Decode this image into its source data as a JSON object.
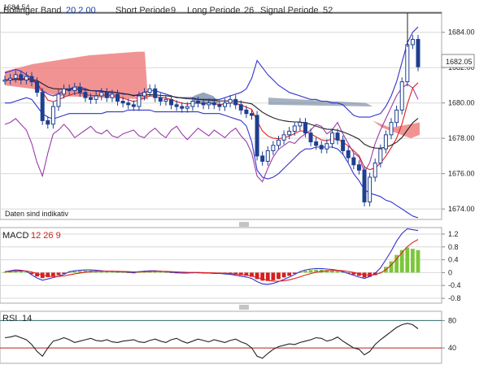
{
  "colors": {
    "background": "#ffffff",
    "frame": "#aaaaaa",
    "grid": "#d8d8d8",
    "candle": "#1f3f8f",
    "bollinger": "#3333cc",
    "cloud_red": "#f08080",
    "cloud_dark": "#6a7f9a",
    "line_red": "#e02020",
    "line_purple": "#9a3aa8",
    "line_black": "#222222",
    "macd_pos": "#7cc63a",
    "macd_neg": "#d42020",
    "rsi_line": "#4a7a7a"
  },
  "header": {
    "price_tag": "1684.54",
    "legend": [
      {
        "name": "Bollinger Band",
        "params": "20  2.00"
      },
      {
        "name": "Short Periode",
        "params": "9"
      },
      {
        "name": "Long Periode",
        "params": "26"
      },
      {
        "name": "Signal Periode",
        "params": "52"
      }
    ]
  },
  "notice": "Daten sind indikativ",
  "current_price_label": "1682.05",
  "macd": {
    "label": "MACD",
    "params": "12  26  9"
  },
  "rsi": {
    "label": "RSI",
    "params": "14"
  },
  "chart_data": [
    {
      "type": "candlestick",
      "ylim": [
        1673.5,
        1685.0
      ],
      "yticks": [
        "1674.00",
        "1676.00",
        "1678.00",
        "1680.00",
        "1682.00",
        "1684.00"
      ],
      "current_price": 1682.05,
      "close": [
        1681.3,
        1681.4,
        1681.6,
        1681.3,
        1681.5,
        1681.2,
        1680.6,
        1679.0,
        1678.8,
        1679.8,
        1680.5,
        1680.8,
        1680.7,
        1680.9,
        1680.6,
        1680.3,
        1680.2,
        1680.4,
        1680.6,
        1680.3,
        1680.5,
        1680.1,
        1680.0,
        1679.9,
        1679.8,
        1680.4,
        1680.6,
        1680.8,
        1680.3,
        1680.1,
        1680.2,
        1679.9,
        1679.8,
        1679.7,
        1679.8,
        1680.1,
        1680.0,
        1679.9,
        1680.0,
        1679.9,
        1679.8,
        1680.0,
        1680.2,
        1679.9,
        1679.6,
        1679.4,
        1679.3,
        1677.0,
        1676.7,
        1677.3,
        1677.6,
        1677.9,
        1678.2,
        1678.4,
        1678.7,
        1678.9,
        1678.3,
        1677.8,
        1677.6,
        1677.4,
        1677.7,
        1678.3,
        1677.9,
        1677.3,
        1676.9,
        1676.5,
        1676.2,
        1674.4,
        1675.8,
        1676.6,
        1677.4,
        1678.2,
        1678.9,
        1679.6,
        1681.2,
        1683.3,
        1683.6,
        1682.05
      ],
      "upper_band": [
        1681.7,
        1681.8,
        1681.9,
        1681.8,
        1681.6,
        1681.4,
        1681.0,
        1680.7,
        1680.5,
        1680.4,
        1680.5,
        1680.7,
        1680.8,
        1680.9,
        1680.9,
        1680.8,
        1680.7,
        1680.7,
        1680.7,
        1680.6,
        1680.6,
        1680.6,
        1680.5,
        1680.5,
        1680.4,
        1680.5,
        1680.6,
        1680.7,
        1680.7,
        1680.6,
        1680.5,
        1680.4,
        1680.3,
        1680.3,
        1680.3,
        1680.3,
        1680.2,
        1680.2,
        1680.2,
        1680.2,
        1680.2,
        1680.3,
        1680.4,
        1680.5,
        1680.6,
        1680.8,
        1681.4,
        1682.4,
        1682.0,
        1681.6,
        1681.3,
        1681.0,
        1680.8,
        1680.6,
        1680.5,
        1680.4,
        1680.3,
        1680.2,
        1680.2,
        1680.1,
        1680.1,
        1680.0,
        1680.0,
        1679.9,
        1679.6,
        1679.3,
        1679.2,
        1679.2,
        1679.2,
        1679.3,
        1679.4,
        1679.8,
        1680.4,
        1681.2,
        1682.3,
        1683.4,
        1684.0,
        1684.3
      ],
      "lower_band": [
        1680.0,
        1680.0,
        1680.1,
        1680.2,
        1680.3,
        1680.2,
        1679.8,
        1679.4,
        1679.2,
        1679.1,
        1679.2,
        1679.3,
        1679.4,
        1679.4,
        1679.4,
        1679.4,
        1679.4,
        1679.4,
        1679.4,
        1679.5,
        1679.5,
        1679.5,
        1679.5,
        1679.6,
        1679.6,
        1679.6,
        1679.6,
        1679.6,
        1679.5,
        1679.5,
        1679.5,
        1679.5,
        1679.5,
        1679.5,
        1679.5,
        1679.5,
        1679.5,
        1679.4,
        1679.4,
        1679.4,
        1679.4,
        1679.3,
        1679.2,
        1679.1,
        1679.0,
        1678.7,
        1677.8,
        1676.2,
        1675.8,
        1675.7,
        1675.8,
        1676.0,
        1676.3,
        1676.6,
        1676.9,
        1677.2,
        1677.4,
        1677.4,
        1677.5,
        1677.5,
        1677.5,
        1677.5,
        1677.4,
        1677.1,
        1676.6,
        1676.0,
        1675.6,
        1675.1,
        1674.9,
        1674.8,
        1674.7,
        1674.5,
        1674.4,
        1674.2,
        1674.0,
        1673.8,
        1673.6,
        1673.5
      ],
      "cloud": {
        "upper": 1682.9,
        "lower": 1680.2,
        "lower_right": 1678.2,
        "upper_right": 1678.9
      }
    },
    {
      "type": "bar",
      "name": "MACD",
      "ylim": [
        -0.9,
        1.3
      ],
      "yticks": [
        "1.2",
        "0.8",
        "0.4",
        "0",
        "-0.4",
        "-0.8"
      ],
      "histogram": [
        0.02,
        0.04,
        0.06,
        0.05,
        0.03,
        -0.05,
        -0.12,
        -0.17,
        -0.14,
        -0.11,
        -0.08,
        -0.04,
        0.02,
        0.04,
        0.05,
        0.06,
        0.06,
        0.05,
        0.04,
        0.03,
        0.03,
        0.02,
        0.02,
        0.01,
        0.0,
        0.02,
        0.03,
        0.04,
        0.04,
        0.03,
        0.02,
        0.01,
        0.0,
        -0.01,
        -0.01,
        0.0,
        0.0,
        -0.01,
        -0.01,
        -0.02,
        -0.02,
        -0.03,
        -0.04,
        -0.06,
        -0.08,
        -0.1,
        -0.13,
        -0.2,
        -0.25,
        -0.26,
        -0.24,
        -0.2,
        -0.15,
        -0.1,
        -0.04,
        0.02,
        0.06,
        0.08,
        0.09,
        0.09,
        0.08,
        0.07,
        0.05,
        0.02,
        -0.02,
        -0.06,
        -0.1,
        -0.15,
        -0.13,
        -0.08,
        0.02,
        0.18,
        0.35,
        0.55,
        0.7,
        0.78,
        0.74,
        0.7
      ]
    },
    {
      "type": "line",
      "name": "RSI",
      "ylim": [
        20,
        90
      ],
      "yticks": [
        "80",
        "40"
      ],
      "values": [
        55,
        56,
        58,
        55,
        52,
        45,
        35,
        28,
        40,
        50,
        52,
        55,
        52,
        48,
        50,
        52,
        54,
        51,
        50,
        52,
        49,
        48,
        50,
        51,
        52,
        49,
        48,
        51,
        53,
        50,
        48,
        52,
        54,
        50,
        47,
        50,
        53,
        51,
        49,
        52,
        50,
        48,
        51,
        53,
        49,
        46,
        40,
        28,
        25,
        32,
        38,
        42,
        44,
        46,
        45,
        48,
        50,
        52,
        55,
        54,
        50,
        52,
        56,
        50,
        45,
        40,
        38,
        30,
        35,
        45,
        52,
        58,
        64,
        70,
        74,
        76,
        74,
        68
      ]
    }
  ]
}
